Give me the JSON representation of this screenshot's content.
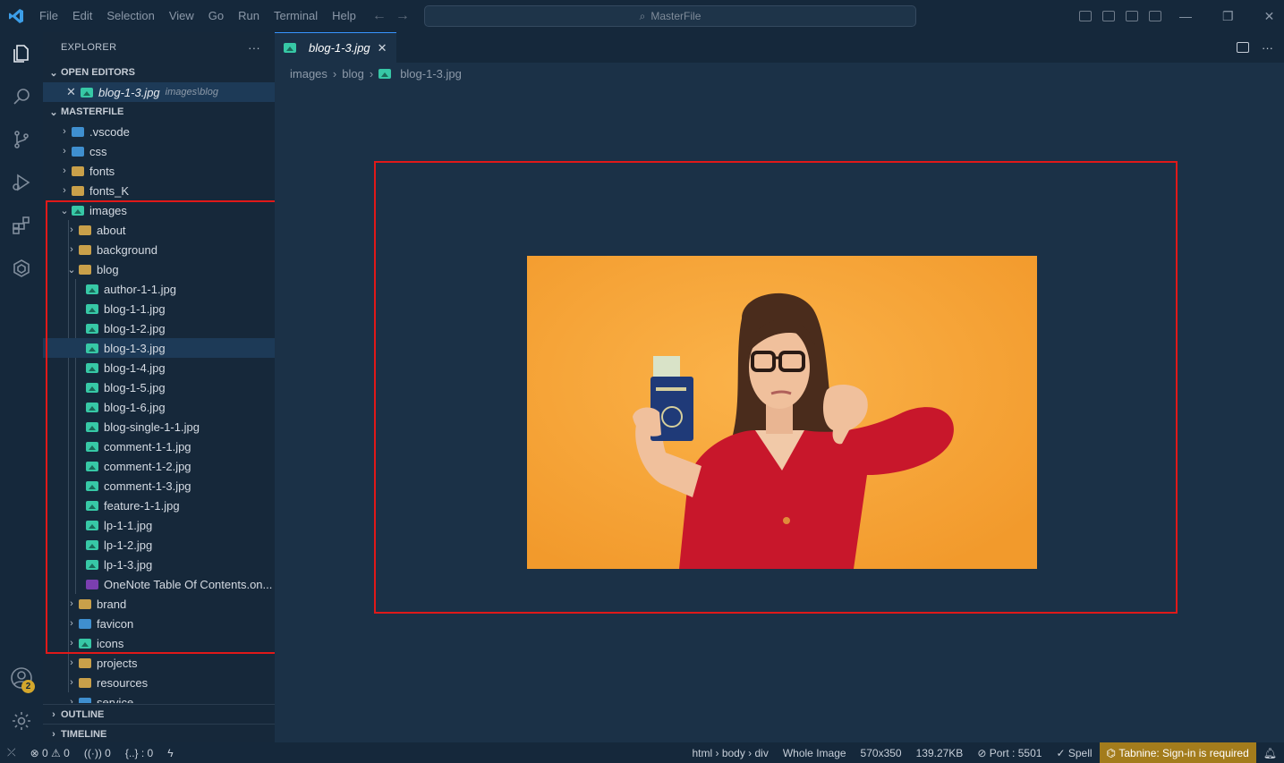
{
  "window": {
    "menu": [
      "File",
      "Edit",
      "Selection",
      "View",
      "Go",
      "Run",
      "Terminal",
      "Help"
    ],
    "search_text": "MasterFile"
  },
  "explorer": {
    "title": "EXPLORER",
    "more": "···",
    "open_editors_label": "OPEN EDITORS",
    "open_editor": {
      "name": "blog-1-3.jpg",
      "path": "images\\blog"
    },
    "workspace_label": "MASTERFILE",
    "tree": [
      {
        "label": ".vscode",
        "depth": 0,
        "type": "folder-b",
        "chev": "›"
      },
      {
        "label": "css",
        "depth": 0,
        "type": "folder-b",
        "chev": "›"
      },
      {
        "label": "fonts",
        "depth": 0,
        "type": "folder",
        "chev": "›"
      },
      {
        "label": "fonts_K",
        "depth": 0,
        "type": "folder",
        "chev": "›"
      },
      {
        "label": "images",
        "depth": 0,
        "type": "img",
        "chev": "⌄"
      },
      {
        "label": "about",
        "depth": 1,
        "type": "folder",
        "chev": "›"
      },
      {
        "label": "background",
        "depth": 1,
        "type": "folder",
        "chev": "›"
      },
      {
        "label": "blog",
        "depth": 1,
        "type": "folder",
        "chev": "⌄"
      },
      {
        "label": "author-1-1.jpg",
        "depth": 2,
        "type": "img",
        "chev": ""
      },
      {
        "label": "blog-1-1.jpg",
        "depth": 2,
        "type": "img",
        "chev": ""
      },
      {
        "label": "blog-1-2.jpg",
        "depth": 2,
        "type": "img",
        "chev": ""
      },
      {
        "label": "blog-1-3.jpg",
        "depth": 2,
        "type": "img",
        "chev": "",
        "selected": true
      },
      {
        "label": "blog-1-4.jpg",
        "depth": 2,
        "type": "img",
        "chev": ""
      },
      {
        "label": "blog-1-5.jpg",
        "depth": 2,
        "type": "img",
        "chev": ""
      },
      {
        "label": "blog-1-6.jpg",
        "depth": 2,
        "type": "img",
        "chev": ""
      },
      {
        "label": "blog-single-1-1.jpg",
        "depth": 2,
        "type": "img",
        "chev": ""
      },
      {
        "label": "comment-1-1.jpg",
        "depth": 2,
        "type": "img",
        "chev": ""
      },
      {
        "label": "comment-1-2.jpg",
        "depth": 2,
        "type": "img",
        "chev": ""
      },
      {
        "label": "comment-1-3.jpg",
        "depth": 2,
        "type": "img",
        "chev": ""
      },
      {
        "label": "feature-1-1.jpg",
        "depth": 2,
        "type": "img",
        "chev": ""
      },
      {
        "label": "lp-1-1.jpg",
        "depth": 2,
        "type": "img",
        "chev": ""
      },
      {
        "label": "lp-1-2.jpg",
        "depth": 2,
        "type": "img",
        "chev": ""
      },
      {
        "label": "lp-1-3.jpg",
        "depth": 2,
        "type": "img",
        "chev": ""
      },
      {
        "label": "OneNote Table Of Contents.on...",
        "depth": 2,
        "type": "onenote",
        "chev": ""
      },
      {
        "label": "brand",
        "depth": 1,
        "type": "folder",
        "chev": "›"
      },
      {
        "label": "favicon",
        "depth": 1,
        "type": "folder-b",
        "chev": "›"
      },
      {
        "label": "icons",
        "depth": 1,
        "type": "img",
        "chev": "›"
      },
      {
        "label": "projects",
        "depth": 1,
        "type": "folder",
        "chev": "›"
      },
      {
        "label": "resources",
        "depth": 1,
        "type": "folder",
        "chev": "›"
      },
      {
        "label": "service",
        "depth": 1,
        "type": "folder-b",
        "chev": "›"
      }
    ],
    "outline_label": "OUTLINE",
    "timeline_label": "TIMELINE"
  },
  "editor": {
    "tab_label": "blog-1-3.jpg",
    "breadcrumb": [
      "images",
      "blog",
      "blog-1-3.jpg"
    ],
    "image_alt": "Woman in red jacket holding a passport and giving a thumbs down"
  },
  "accounts_badge": "2",
  "statusbar": {
    "errors": "0",
    "warnings": "0",
    "ports": "0",
    "json": "{..} : 0",
    "path": "html › body › div",
    "zoom": "Whole Image",
    "dims": "570x350",
    "size": "139.27KB",
    "port": "Port : 5501",
    "spell": "Spell",
    "tabnine": "Tabnine: Sign-in is required"
  },
  "colors": {
    "accent": "#3794ff",
    "highlight": "#e01919",
    "tabnine": "#a37c1c"
  }
}
